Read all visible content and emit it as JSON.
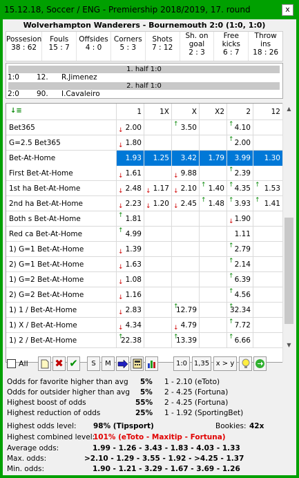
{
  "window": {
    "title": "15.12.18, Soccer / ENG - Premiership 2018/2019, 17. round",
    "close_label": "x"
  },
  "match": {
    "title": "Wolverhampton Wanderers - Bournemouth 2:0 (1:0, 1:0)"
  },
  "stats": [
    {
      "label": "Possesion",
      "value": "38 : 62"
    },
    {
      "label": "Fouls",
      "value": "15 : 7"
    },
    {
      "label": "Offsides",
      "value": "4 : 0"
    },
    {
      "label": "Corners",
      "value": "5 : 3"
    },
    {
      "label": "Shots",
      "value": "7 : 12"
    },
    {
      "label": "Sh. on goal",
      "value": "2 : 3"
    },
    {
      "label": "Free kicks",
      "value": "6 : 7"
    },
    {
      "label": "Throw ins",
      "value": "18 : 26"
    }
  ],
  "events": {
    "half1": "1. half 1:0",
    "goal1": {
      "score": "1:0",
      "minute": "12.",
      "player": "R.Jimenez"
    },
    "half2": "2. half 1:0",
    "goal2": {
      "score": "2:0",
      "minute": "90.",
      "player": "I.Cavaleiro"
    }
  },
  "grid": {
    "columns": [
      "1",
      "1X",
      "X",
      "X2",
      "2",
      "12"
    ],
    "rows": [
      {
        "name": "Bet365",
        "v": [
          "2.00",
          "",
          "3.50",
          "",
          "4.10",
          ""
        ],
        "a": [
          "d",
          "",
          "u",
          "",
          "u",
          ""
        ]
      },
      {
        "name": "G=2.5 Bet365",
        "v": [
          "1.80",
          "",
          "",
          "",
          "2.00",
          ""
        ],
        "a": [
          "d",
          "",
          "",
          "",
          "u",
          ""
        ]
      },
      {
        "name": "Bet-At-Home",
        "v": [
          "1.93",
          "1.25",
          "3.42",
          "1.79",
          "3.99",
          "1.30"
        ],
        "a": [
          "",
          "",
          "",
          "",
          "",
          ""
        ],
        "selected": true
      },
      {
        "name": "First  Bet-At-Home",
        "v": [
          "1.61",
          "",
          "9.88",
          "",
          "2.39",
          ""
        ],
        "a": [
          "d",
          "",
          "d",
          "",
          "u",
          ""
        ]
      },
      {
        "name": "1st ha Bet-At-Home",
        "v": [
          "2.48",
          "1.17",
          "2.10",
          "1.40",
          "4.35",
          "1.53"
        ],
        "a": [
          "d",
          "d",
          "d",
          "u",
          "u",
          "u"
        ]
      },
      {
        "name": "2nd ha Bet-At-Home",
        "v": [
          "2.23",
          "1.20",
          "2.45",
          "1.48",
          "3.93",
          "1.41"
        ],
        "a": [
          "d",
          "d",
          "d",
          "u",
          "u",
          "u"
        ]
      },
      {
        "name": "Both s Bet-At-Home",
        "v": [
          "1.81",
          "",
          "",
          "",
          "1.90",
          ""
        ],
        "a": [
          "u",
          "",
          "",
          "",
          "d",
          ""
        ]
      },
      {
        "name": "Red ca Bet-At-Home",
        "v": [
          "4.99",
          "",
          "",
          "",
          "1.11",
          ""
        ],
        "a": [
          "u",
          "",
          "",
          "",
          "",
          ""
        ]
      },
      {
        "name": "1) G=1 Bet-At-Home",
        "v": [
          "1.39",
          "",
          "",
          "",
          "2.79",
          ""
        ],
        "a": [
          "d",
          "",
          "",
          "",
          "u",
          ""
        ]
      },
      {
        "name": "2) G=1 Bet-At-Home",
        "v": [
          "1.63",
          "",
          "",
          "",
          "2.14",
          ""
        ],
        "a": [
          "d",
          "",
          "",
          "",
          "u",
          ""
        ]
      },
      {
        "name": "1) G=2 Bet-At-Home",
        "v": [
          "1.08",
          "",
          "",
          "",
          "6.39",
          ""
        ],
        "a": [
          "d",
          "",
          "",
          "",
          "u",
          ""
        ]
      },
      {
        "name": "2) G=2 Bet-At-Home",
        "v": [
          "1.16",
          "",
          "",
          "",
          "4.56",
          ""
        ],
        "a": [
          "d",
          "",
          "",
          "",
          "u",
          ""
        ]
      },
      {
        "name": "1) 1 / Bet-At-Home",
        "v": [
          "2.83",
          "",
          "12.79",
          "",
          "32.34",
          ""
        ],
        "a": [
          "d",
          "",
          "u",
          "",
          "u",
          ""
        ]
      },
      {
        "name": "1) X / Bet-At-Home",
        "v": [
          "4.34",
          "",
          "4.79",
          "",
          "7.72",
          ""
        ],
        "a": [
          "d",
          "",
          "d",
          "",
          "u",
          ""
        ]
      },
      {
        "name": "1) 2 / Bet-At-Home",
        "v": [
          "22.38",
          "",
          "13.39",
          "",
          "6.66",
          ""
        ],
        "a": [
          "u",
          "",
          "u",
          "",
          "u",
          ""
        ]
      }
    ]
  },
  "toolbar": {
    "all_label": "All",
    "s_label": "S",
    "m_label": "M",
    "btn_10": "1:0",
    "btn_135": "1,35",
    "btn_xy": "x > y"
  },
  "summary": {
    "fav_label": "Odds for favorite higher than avg",
    "fav_pct": "5%",
    "fav_info": "1 - 2.10 (eToto)",
    "out_label": "Odds for outsider higher than avg",
    "out_pct": "5%",
    "out_info": "2 - 4.25 (Fortuna)",
    "boost_label": "Highest boost of odds",
    "boost_pct": "55%",
    "boost_info": "2 - 4.25 (Fortuna)",
    "red_label": "Highest reduction of odds",
    "red_pct": "25%",
    "red_info": "1 - 1.92 (SportingBet)",
    "level_label": "Highest odds level:",
    "level_val": "98%  (Tipsport)",
    "bookies_label": "Bookies:",
    "bookies_val": "42x",
    "comb_label": "Highest combined level:",
    "comb_val": "101%  (eToto - Maxitip - Fortuna)",
    "avg_label": "Average odds:",
    "avg_val": "1.99 - 1.26 - 3.43 - 1.83 - 4.03 - 1.33",
    "max_label": "Max. odds:",
    "max_val": ">2.10 - 1.29 - 3.55 - 1.92 - >4.25 - 1.37",
    "min_label": "Min. odds:",
    "min_val": "1.90 - 1.21 - 3.29 - 1.67 - 3.69 - 1.26"
  },
  "colors": {
    "titlebar": "#00a000",
    "selected": "#0078d7",
    "up_arrow": "#0a8a0a",
    "down_arrow": "#d00000",
    "highlight_red": "#e00000"
  }
}
